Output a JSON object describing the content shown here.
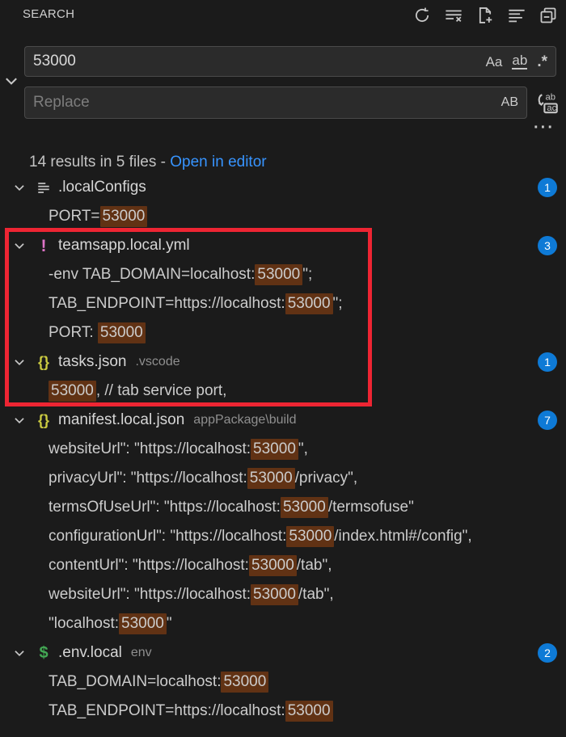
{
  "panel": {
    "title": "SEARCH"
  },
  "toolbar": {
    "icons": [
      "refresh",
      "clear-search-results",
      "open-new-search-editor",
      "view-as-list",
      "collapse-all"
    ],
    "more_actions_glyph": "···"
  },
  "search": {
    "query": "53000",
    "match_case_label": "Aa",
    "whole_word_label": "ab",
    "regex_label": ".*"
  },
  "replace": {
    "placeholder": "Replace",
    "preserve_case_label": "AB"
  },
  "results": {
    "summary": "14 results in 5 files - ",
    "open_in_editor_label": "Open in editor"
  },
  "colors": {
    "match_highlight": "#613214",
    "badge": "#0e7ad6",
    "link": "#3794ff",
    "annotation_border": "#ee2533",
    "yaml_icon": "#de74c8",
    "json_icon": "#cbcb41",
    "env_icon": "#43a854",
    "file_icon": "#c8c8c8"
  },
  "files": [
    {
      "name": ".localConfigs",
      "path": "",
      "badge": "1",
      "icon": "file-lines",
      "matches": [
        {
          "pre": "PORT=",
          "match": "53000",
          "post": ""
        }
      ]
    },
    {
      "name": "teamsapp.local.yml",
      "path": "",
      "badge": "3",
      "icon": "yaml-exclamation",
      "matches": [
        {
          "pre": "-env TAB_DOMAIN=localhost:",
          "match": "53000",
          "post": "\";"
        },
        {
          "pre": "TAB_ENDPOINT=https://localhost:",
          "match": "53000",
          "post": "\";"
        },
        {
          "pre": "PORT: ",
          "match": "53000",
          "post": ""
        }
      ]
    },
    {
      "name": "tasks.json",
      "path": ".vscode",
      "badge": "1",
      "icon": "json-braces",
      "matches": [
        {
          "pre": "",
          "match": "53000",
          "post": ", // tab service port,"
        }
      ]
    },
    {
      "name": "manifest.local.json",
      "path": "appPackage\\build",
      "badge": "7",
      "icon": "json-braces",
      "matches": [
        {
          "pre": "websiteUrl\": \"https://localhost:",
          "match": "53000",
          "post": "\","
        },
        {
          "pre": "privacyUrl\": \"https://localhost:",
          "match": "53000",
          "post": "/privacy\","
        },
        {
          "pre": "termsOfUseUrl\": \"https://localhost:",
          "match": "53000",
          "post": "/termsofuse\""
        },
        {
          "pre": "configurationUrl\": \"https://localhost:",
          "match": "53000",
          "post": "/index.html#/config\","
        },
        {
          "pre": "contentUrl\": \"https://localhost:",
          "match": "53000",
          "post": "/tab\","
        },
        {
          "pre": "websiteUrl\": \"https://localhost:",
          "match": "53000",
          "post": "/tab\","
        },
        {
          "pre": "\"localhost:",
          "match": "53000",
          "post": "\""
        }
      ]
    },
    {
      "name": ".env.local",
      "path": "env",
      "badge": "2",
      "icon": "env-dollar",
      "matches": [
        {
          "pre": "TAB_DOMAIN=localhost:",
          "match": "53000",
          "post": ""
        },
        {
          "pre": "TAB_ENDPOINT=https://localhost:",
          "match": "53000",
          "post": ""
        }
      ]
    }
  ],
  "annotation": {
    "color": "#ee2533",
    "encloses": "teamsapp.local.yml results and tasks.json result"
  }
}
